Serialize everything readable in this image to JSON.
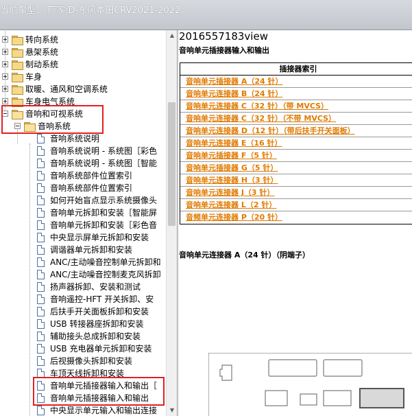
{
  "window": {
    "title": "当前车型：  厂家:D-东风本田CRV2021-2022"
  },
  "tree": {
    "partial_top": "",
    "items": [
      {
        "label": "转向系统"
      },
      {
        "label": "悬架系统"
      },
      {
        "label": "制动系统"
      },
      {
        "label": "车身"
      },
      {
        "label": "取暖、通风和空调系统"
      },
      {
        "label": "车身电气系统"
      },
      {
        "label": "音响和可视系统"
      },
      {
        "label": "音响系统"
      },
      {
        "label": "音响系统说明"
      },
      {
        "label": "音响系统说明 - 系统图［彩色"
      },
      {
        "label": "音响系统说明 - 系统图［智能"
      },
      {
        "label": "音响系统部件位置索引"
      },
      {
        "label": "音响系统部件位置索引"
      },
      {
        "label": "如何开始盲点显示系统摄像头"
      },
      {
        "label": "音响单元拆卸和安装［智能屏"
      },
      {
        "label": "音响单元拆卸和安装［彩色音"
      },
      {
        "label": "中央显示屏单元拆卸和安装"
      },
      {
        "label": "调谐器单元拆卸和安装"
      },
      {
        "label": "ANC/主动噪音控制单元拆卸和"
      },
      {
        "label": "ANC/主动噪音控制麦克风拆卸"
      },
      {
        "label": "扬声器拆卸、安装和测试"
      },
      {
        "label": "音响遥控-HFT 开关拆卸、安"
      },
      {
        "label": "后扶手开关面板拆卸和安装"
      },
      {
        "label": "USB 转接器座拆卸和安装"
      },
      {
        "label": "辅助接头总成拆卸和安装"
      },
      {
        "label": "USB 充电器单元拆卸和安装"
      },
      {
        "label": "后视摄像头拆卸和安装"
      },
      {
        "label": "车顶天线拆卸和安装"
      },
      {
        "label": "音响单元插接器输入和输出［"
      },
      {
        "label": "音响单元插接器输入和输出"
      },
      {
        "label": "中央显示单元输入和输出连接"
      }
    ]
  },
  "content": {
    "doc_id": "2016557183view",
    "title": "音响单元插接器输入和输出",
    "table_header": "插接器索引",
    "connectors": [
      "音响单元插接器 A（24 针）",
      "音响单元连接器 B（24 针）",
      "音响单元连接器 C（32 针）（带 MVCS）",
      "音响单元连接器 C（32 针）（不带 MVCS）",
      "音响单元连接器 D（12 针）（带后扶手开关面板）",
      "音响单元连接器 E（16 针）",
      "音响单元插接器 F（5 针）",
      "音响单元插接器 G（5 针）",
      "音响单元连接器 H（3 针）",
      "音响单元连接器 J（3 针）",
      "音响单元连接器 L（2 针）",
      "音频单元连接器 P（20 针）"
    ],
    "section_heading": "音响单元连接器 A（24 针）（阴端子）"
  },
  "colors": {
    "link": "#e07a00",
    "highlight": "#e02020"
  }
}
